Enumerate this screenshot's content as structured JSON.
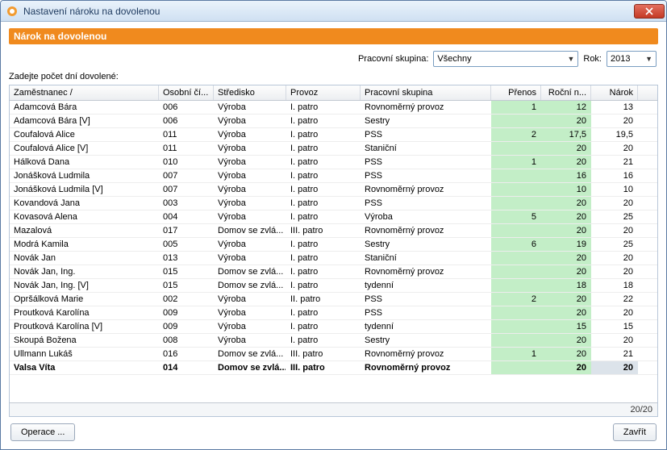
{
  "window": {
    "title": "Nastavení nároku na dovolenou"
  },
  "header": {
    "banner": "Nárok na dovolenou"
  },
  "toolbar": {
    "group_label": "Pracovní skupina:",
    "group_value": "Všechny",
    "year_label": "Rok:",
    "year_value": "2013"
  },
  "section_label": "Zadejte počet dní dovolené:",
  "columns": {
    "zamestnanec": "Zaměstnanec   /",
    "osobni": "Osobní čí...",
    "stredisko": "Středisko",
    "provoz": "Provoz",
    "skupina": "Pracovní skupina",
    "prenos": "Přenos",
    "rocni": "Roční n...",
    "narok": "Nárok"
  },
  "rows": [
    {
      "name": "Adamcová Bára",
      "osobni": "006",
      "stredisko": "Výroba",
      "provoz": "I. patro",
      "skupina": "Rovnoměrný provoz",
      "prenos": "1",
      "rocni": "12",
      "narok": "13"
    },
    {
      "name": "Adamcová Bára [V]",
      "osobni": "006",
      "stredisko": "Výroba",
      "provoz": "I. patro",
      "skupina": "Sestry",
      "prenos": "",
      "rocni": "20",
      "narok": "20"
    },
    {
      "name": "Coufalová Alice",
      "osobni": "011",
      "stredisko": "Výroba",
      "provoz": "I. patro",
      "skupina": "PSS",
      "prenos": "2",
      "rocni": "17,5",
      "narok": "19,5"
    },
    {
      "name": "Coufalová Alice [V]",
      "osobni": "011",
      "stredisko": "Výroba",
      "provoz": "I. patro",
      "skupina": "Staniční",
      "prenos": "",
      "rocni": "20",
      "narok": "20"
    },
    {
      "name": "Hálková Dana",
      "osobni": "010",
      "stredisko": "Výroba",
      "provoz": "I. patro",
      "skupina": "PSS",
      "prenos": "1",
      "rocni": "20",
      "narok": "21"
    },
    {
      "name": "Jonášková Ludmila",
      "osobni": "007",
      "stredisko": "Výroba",
      "provoz": "I. patro",
      "skupina": "PSS",
      "prenos": "",
      "rocni": "16",
      "narok": "16"
    },
    {
      "name": "Jonášková Ludmila [V]",
      "osobni": "007",
      "stredisko": "Výroba",
      "provoz": "I. patro",
      "skupina": "Rovnoměrný provoz",
      "prenos": "",
      "rocni": "10",
      "narok": "10"
    },
    {
      "name": "Kovandová Jana",
      "osobni": "003",
      "stredisko": "Výroba",
      "provoz": "I. patro",
      "skupina": "PSS",
      "prenos": "",
      "rocni": "20",
      "narok": "20"
    },
    {
      "name": "Kovasová Alena",
      "osobni": "004",
      "stredisko": "Výroba",
      "provoz": "I. patro",
      "skupina": "Výroba",
      "prenos": "5",
      "rocni": "20",
      "narok": "25"
    },
    {
      "name": "Mazalová",
      "osobni": "017",
      "stredisko": "Domov se zvlá...",
      "provoz": "III. patro",
      "skupina": "Rovnoměrný provoz",
      "prenos": "",
      "rocni": "20",
      "narok": "20"
    },
    {
      "name": "Modrá Kamila",
      "osobni": "005",
      "stredisko": "Výroba",
      "provoz": "I. patro",
      "skupina": "Sestry",
      "prenos": "6",
      "rocni": "19",
      "narok": "25"
    },
    {
      "name": "Novák Jan",
      "osobni": "013",
      "stredisko": "Výroba",
      "provoz": "I. patro",
      "skupina": "Staniční",
      "prenos": "",
      "rocni": "20",
      "narok": "20"
    },
    {
      "name": "Novák Jan, Ing.",
      "osobni": "015",
      "stredisko": "Domov se zvlá...",
      "provoz": "I. patro",
      "skupina": "Rovnoměrný provoz",
      "prenos": "",
      "rocni": "20",
      "narok": "20"
    },
    {
      "name": "Novák Jan, Ing. [V]",
      "osobni": "015",
      "stredisko": "Domov se zvlá...",
      "provoz": "I. patro",
      "skupina": "tydenní",
      "prenos": "",
      "rocni": "18",
      "narok": "18"
    },
    {
      "name": "Opršálková Marie",
      "osobni": "002",
      "stredisko": "Výroba",
      "provoz": "II. patro",
      "skupina": "PSS",
      "prenos": "2",
      "rocni": "20",
      "narok": "22"
    },
    {
      "name": "Proutková Karolína",
      "osobni": "009",
      "stredisko": "Výroba",
      "provoz": "I. patro",
      "skupina": "PSS",
      "prenos": "",
      "rocni": "20",
      "narok": "20"
    },
    {
      "name": "Proutková Karolína [V]",
      "osobni": "009",
      "stredisko": "Výroba",
      "provoz": "I. patro",
      "skupina": "tydenní",
      "prenos": "",
      "rocni": "15",
      "narok": "15"
    },
    {
      "name": "Skoupá Božena",
      "osobni": "008",
      "stredisko": "Výroba",
      "provoz": "I. patro",
      "skupina": "Sestry",
      "prenos": "",
      "rocni": "20",
      "narok": "20"
    },
    {
      "name": "Ullmann Lukáš",
      "osobni": "016",
      "stredisko": "Domov se zvlá...",
      "provoz": "III. patro",
      "skupina": "Rovnoměrný provoz",
      "prenos": "1",
      "rocni": "20",
      "narok": "21"
    },
    {
      "name": "Valsa Víta",
      "osobni": "014",
      "stredisko": "Domov se zvlá...",
      "provoz": "III. patro",
      "skupina": "Rovnoměrný provoz",
      "prenos": "",
      "rocni": "20",
      "narok": "20",
      "bold": true,
      "narokSel": true
    }
  ],
  "footer": {
    "count": "20/20"
  },
  "buttons": {
    "operace": "Operace ...",
    "zavrit": "Zavřít"
  }
}
